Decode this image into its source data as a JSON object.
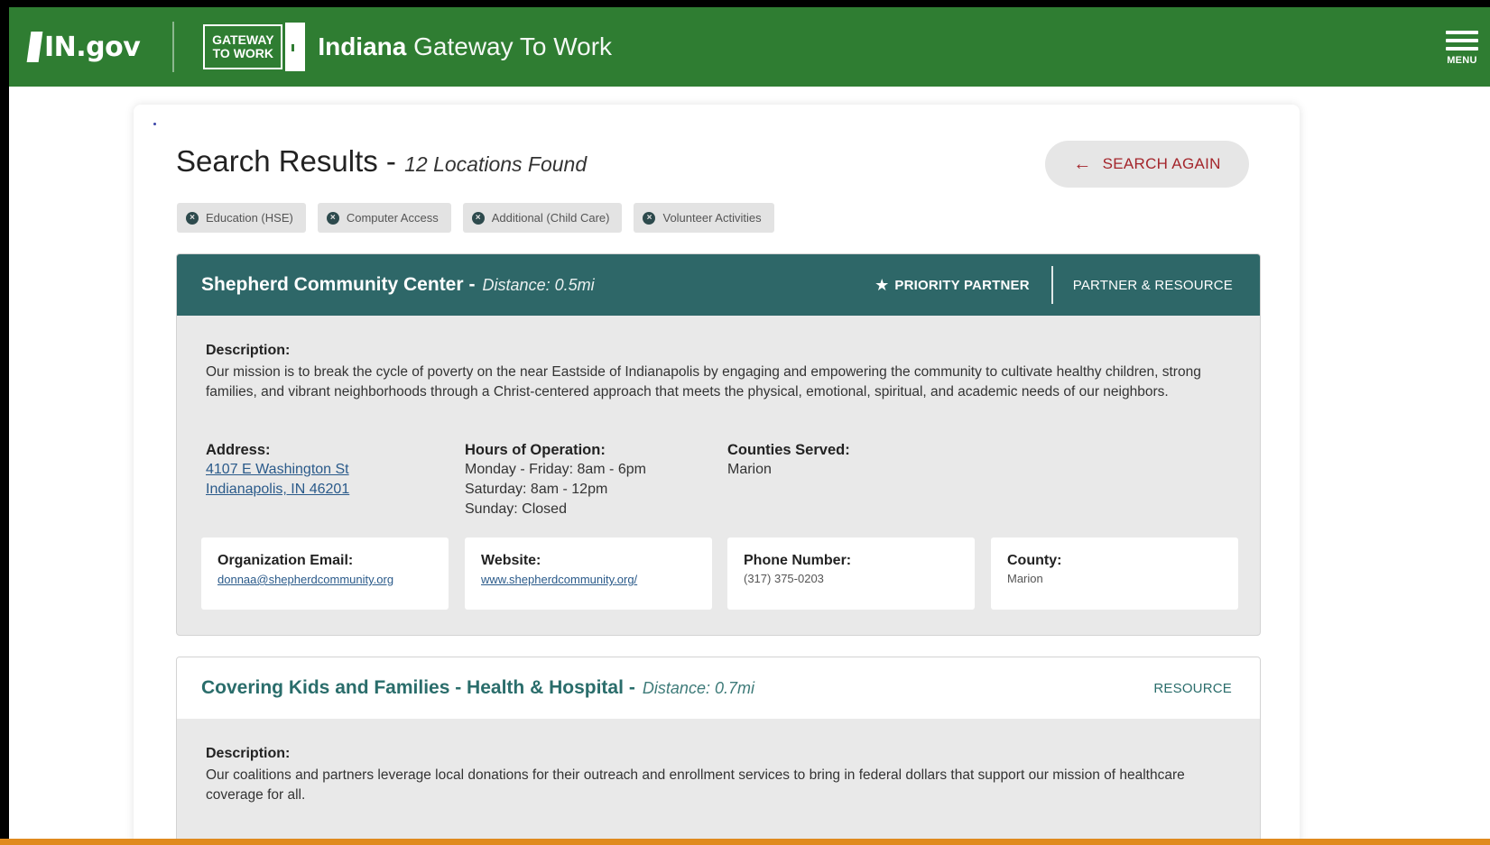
{
  "header": {
    "ingov_logo": "IN.gov",
    "gtw_logo_line1": "GATEWAY",
    "gtw_logo_line2": "TO WORK",
    "site_title_bold": "Indiana",
    "site_title_rest": "Gateway To Work",
    "menu_label": "MENU"
  },
  "results": {
    "title": "Search Results",
    "separator": " - ",
    "count": "12 Locations Found",
    "search_again": "SEARCH AGAIN"
  },
  "filters": [
    {
      "label": "Education (HSE)"
    },
    {
      "label": "Computer Access"
    },
    {
      "label": "Additional (Child Care)"
    },
    {
      "label": "Volunteer Activities"
    }
  ],
  "locations": [
    {
      "name": "Shepherd Community Center",
      "distance": "Distance: 0.5mi",
      "priority": "PRIORITY PARTNER",
      "type": "PARTNER & RESOURCE",
      "description_label": "Description:",
      "description": "Our mission is to break the cycle of poverty on the near Eastside of Indianapolis by engaging and empowering the community to cultivate healthy children, strong families, and vibrant neighborhoods through a Christ-centered approach that meets the physical, emotional, spiritual, and academic needs of our neighbors.",
      "address_label": "Address:",
      "address_line1": "4107 E Washington St",
      "address_line2": "Indianapolis, IN 46201",
      "hours_label": "Hours of Operation:",
      "hours_line1": "Monday - Friday: 8am - 6pm",
      "hours_line2": "Saturday: 8am - 12pm",
      "hours_line3": "Sunday: Closed",
      "counties_label": "Counties Served:",
      "counties": "Marion",
      "email_label": "Organization Email:",
      "email": "donnaa@shepherdcommunity.org",
      "website_label": "Website:",
      "website": "www.shepherdcommunity.org/",
      "phone_label": "Phone Number:",
      "phone": "(317) 375-0203",
      "county_label": "County:",
      "county": "Marion"
    },
    {
      "name": "Covering Kids and Families - Health & Hospital",
      "distance": "Distance: 0.7mi",
      "type": "RESOURCE",
      "description_label": "Description:",
      "description": "Our coalitions and partners leverage local donations for their outreach and enrollment services to bring in federal dollars that support our mission of healthcare coverage for all."
    }
  ],
  "colors": {
    "header_green": "#2f7d32",
    "card_teal": "#2e6768",
    "accent_red": "#a4262c"
  }
}
